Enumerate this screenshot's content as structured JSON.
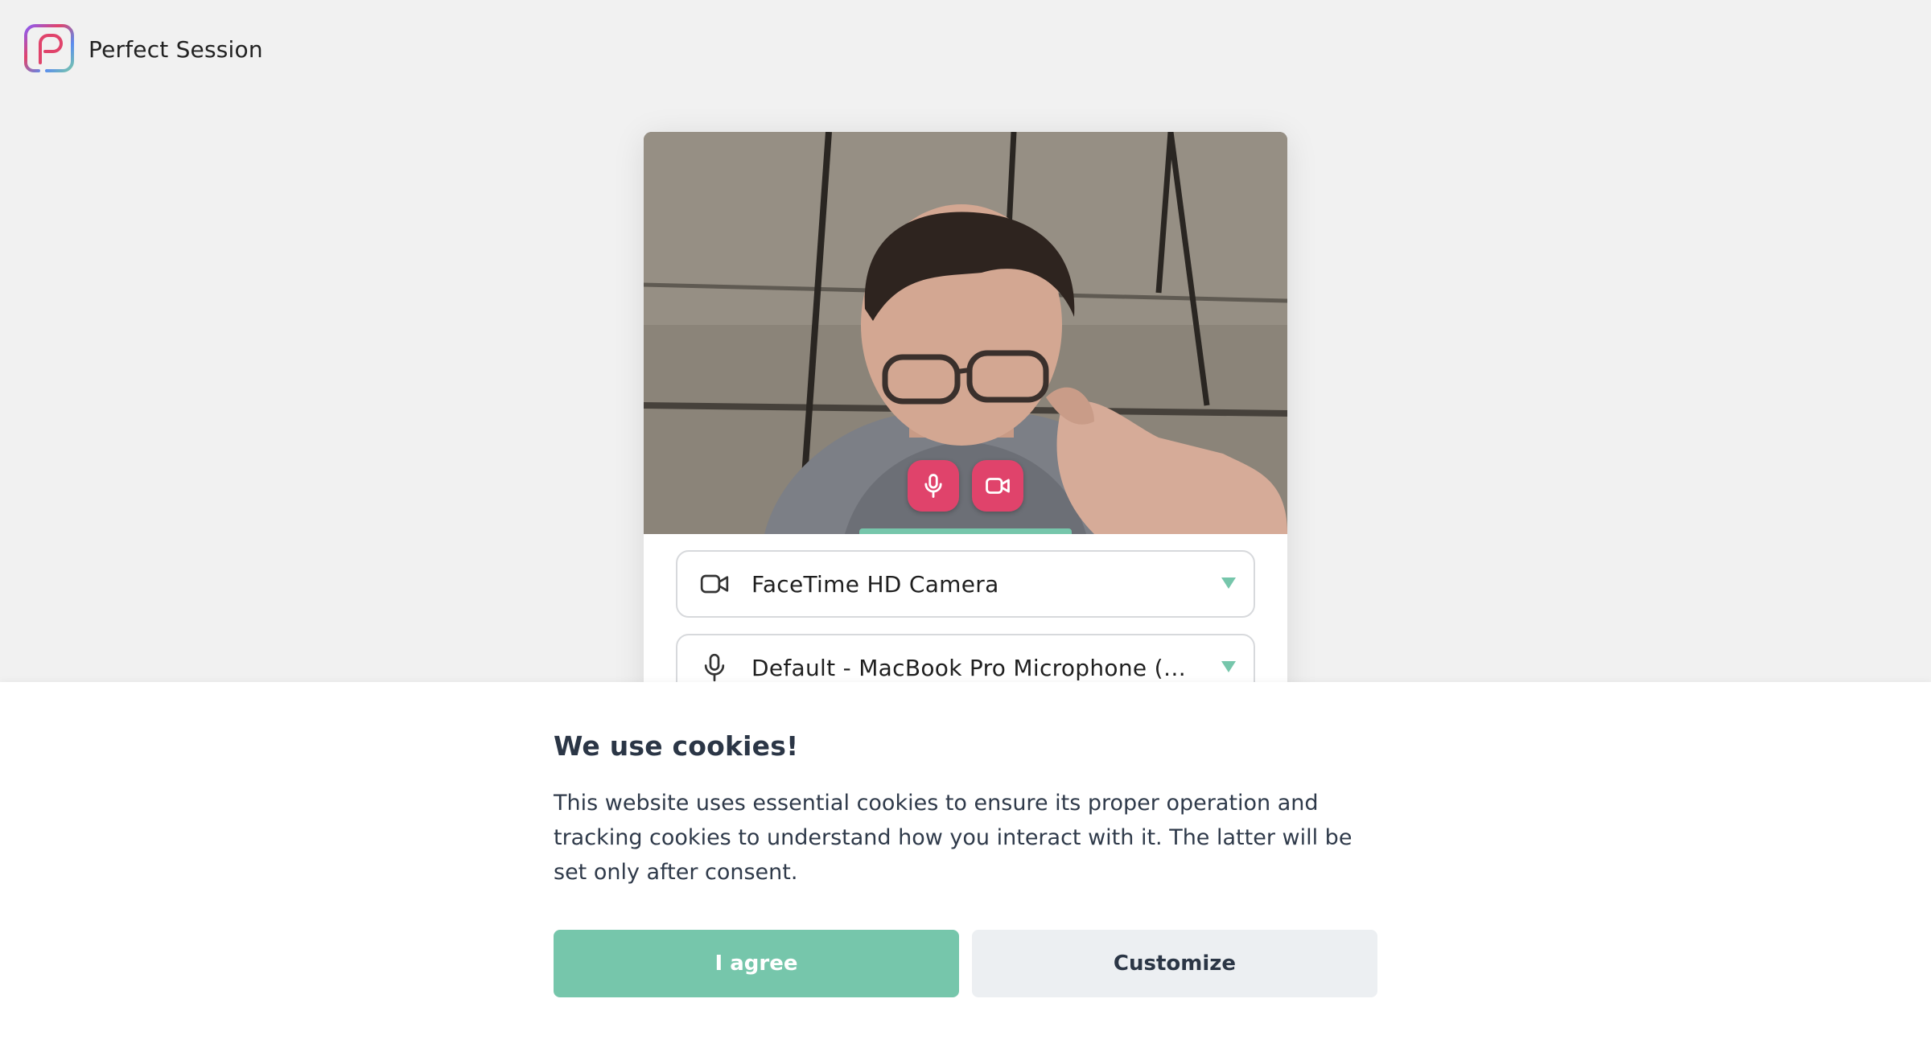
{
  "brand": {
    "name": "Perfect Session"
  },
  "device_setup": {
    "camera_select": {
      "value": "FaceTime HD Camera",
      "icon": "video-camera-icon"
    },
    "microphone_select": {
      "value": "Default - MacBook Pro Microphone (Built...",
      "icon": "microphone-icon"
    },
    "controls": {
      "mic_icon": "microphone-icon",
      "camera_icon": "video-camera-icon",
      "accent": "#e0436b"
    },
    "audio_level_color": "#76c6ab"
  },
  "cookie_banner": {
    "title": "We use cookies!",
    "text": "This website uses essential cookies to ensure its proper operation and tracking cookies to understand how you interact with it. The latter will be set only after consent.",
    "agree_label": "I agree",
    "customize_label": "Customize",
    "agree_color": "#76c6ab"
  }
}
